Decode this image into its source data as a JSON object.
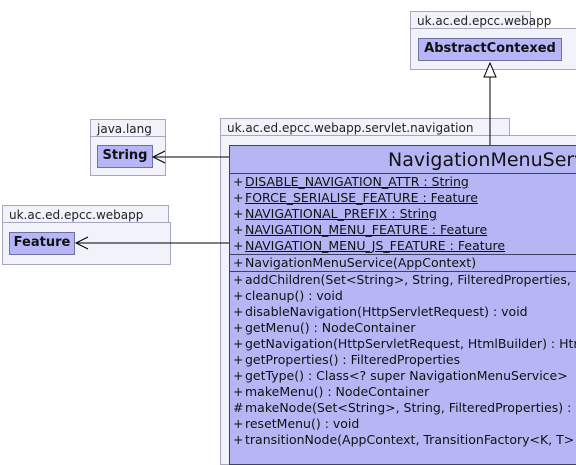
{
  "packages": {
    "top_right": {
      "name": "uk.ac.ed.epcc.webapp",
      "class": "AbstractContexed"
    },
    "java_lang": {
      "name": "java.lang",
      "class": "String"
    },
    "left": {
      "name": "uk.ac.ed.epcc.webapp",
      "class": "Feature"
    },
    "navigation": {
      "name": "uk.ac.ed.epcc.webapp.servlet.navigation"
    }
  },
  "main_class": {
    "name": "NavigationMenuServic",
    "attributes": [
      {
        "vis": "+",
        "text": "DISABLE_NAVIGATION_ATTR : String"
      },
      {
        "vis": "+",
        "text": "FORCE_SERIALISE_FEATURE : Feature"
      },
      {
        "vis": "+",
        "text": "NAVIGATIONAL_PREFIX : String"
      },
      {
        "vis": "+",
        "text": "NAVIGATION_MENU_FEATURE : Feature"
      },
      {
        "vis": "+",
        "text": "NAVIGATION_MENU_JS_FEATURE : Feature"
      }
    ],
    "constructor": {
      "vis": "+",
      "text": "NavigationMenuService(AppContext)"
    },
    "operations": [
      {
        "vis": "+",
        "text": "addChildren(Set<String>, String, FilteredProperties,"
      },
      {
        "vis": "+",
        "text": "cleanup() : void"
      },
      {
        "vis": "+",
        "text": "disableNavigation(HttpServletRequest) : void"
      },
      {
        "vis": "+",
        "text": "getMenu() : NodeContainer"
      },
      {
        "vis": "+",
        "text": "getNavigation(HttpServletRequest, HtmlBuilder) : Htm"
      },
      {
        "vis": "+",
        "text": "getProperties() : FilteredProperties"
      },
      {
        "vis": "+",
        "text": "getType() : Class<? super NavigationMenuService>"
      },
      {
        "vis": "+",
        "text": "makeMenu() : NodeContainer"
      },
      {
        "vis": "#",
        "text": "makeNode(Set<String>, String, FilteredProperties) :"
      },
      {
        "vis": "+",
        "text": "resetMenu() : void"
      },
      {
        "vis": "+",
        "text": "transitionNode(AppContext, TransitionFactory<K, T>"
      }
    ]
  }
}
